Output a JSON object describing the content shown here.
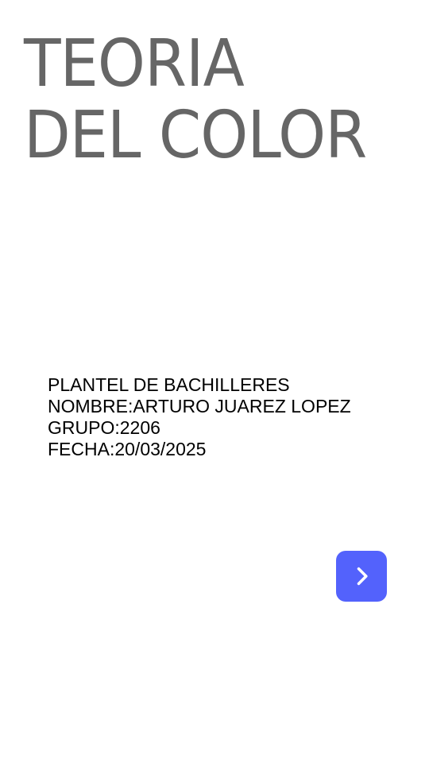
{
  "title": {
    "line1": "TEORIA",
    "line2": "DEL COLOR"
  },
  "info": {
    "school": "PLANTEL DE BACHILLERES",
    "name": "NOMBRE:ARTURO JUAREZ LOPEZ",
    "group": "GRUPO:2206",
    "date": "FECHA:20/03/2025"
  },
  "next_button": {
    "icon": "chevron-right-icon",
    "color": "#5362fc"
  },
  "colors": {
    "title": "#666666",
    "text": "#000000",
    "background": "#ffffff"
  }
}
